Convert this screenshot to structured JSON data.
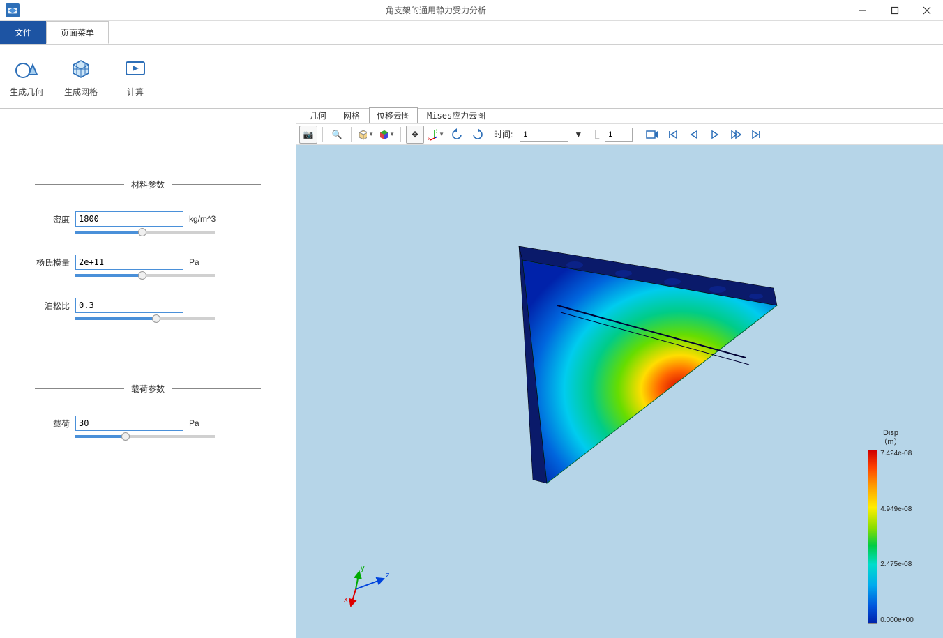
{
  "window": {
    "title": "角支架的通用静力受力分析"
  },
  "menu": {
    "file": "文件",
    "page_menu": "页面菜单"
  },
  "ribbon": {
    "gen_geometry": "生成几何",
    "gen_mesh": "生成网格",
    "compute": "计算"
  },
  "sidebar": {
    "material_section": "材料参数",
    "density": {
      "label": "密度",
      "value": "1800",
      "unit": "kg/m^3",
      "slider_percent": 48
    },
    "young": {
      "label": "杨氏模量",
      "value": "2e+11",
      "unit": "Pa",
      "slider_percent": 48
    },
    "poisson": {
      "label": "泊松比",
      "value": "0.3",
      "unit": "",
      "slider_percent": 58
    },
    "load_section": "载荷参数",
    "load": {
      "label": "载荷",
      "value": "30",
      "unit": "Pa",
      "slider_percent": 36
    }
  },
  "viewer_tabs": {
    "geometry": "几何",
    "mesh": "网格",
    "disp_cloud": "位移云图",
    "mises_cloud": "Mises应力云图"
  },
  "toolbar": {
    "time_label": "时间:",
    "time_value": "1",
    "time_step": "1"
  },
  "legend": {
    "title1": "Disp",
    "title2": "（m）",
    "t0": "7.424e-08",
    "t1": "4.949e-08",
    "t2": "2.475e-08",
    "t3": "0.000e+00"
  },
  "axes": {
    "x": "x",
    "y": "y",
    "z": "z"
  },
  "colors": {
    "primary": "#1d54a3",
    "accent": "#4a90d9"
  },
  "chart_data": {
    "type": "heatmap",
    "title": "Disp （m）",
    "field": "Displacement magnitude",
    "unit": "m",
    "colormap": "rainbow",
    "range_min": 0.0,
    "range_max": 7.424e-08,
    "ticks": [
      7.424e-08,
      4.949e-08,
      2.475e-08,
      0.0
    ],
    "time": 1,
    "geometry": "triangular angle bracket with bolt holes"
  }
}
